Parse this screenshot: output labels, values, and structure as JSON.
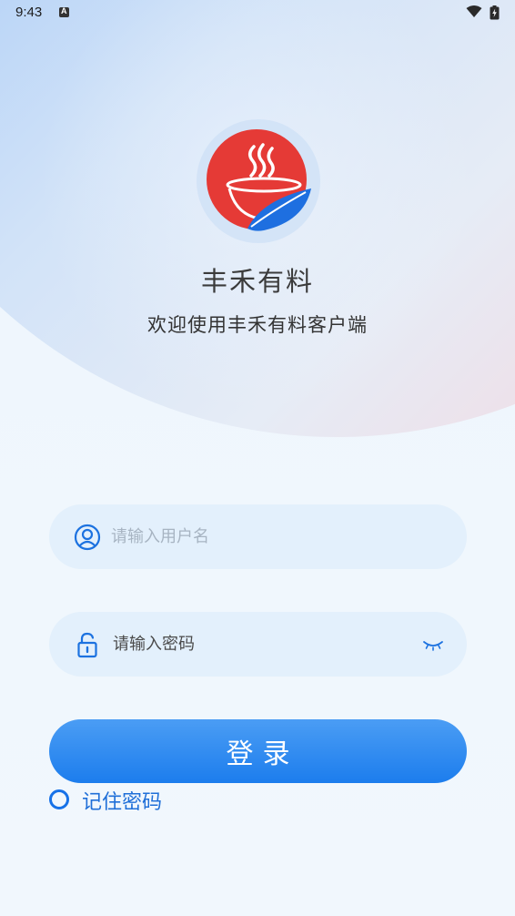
{
  "status_bar": {
    "time": "9:43",
    "icons": [
      "notification-a-icon",
      "wifi-icon",
      "battery-charging-icon"
    ]
  },
  "app": {
    "logo_icon": "steaming-bowl-leaf-logo",
    "title": "丰禾有料",
    "subtitle": "欢迎使用丰禾有料客户端"
  },
  "form": {
    "username": {
      "icon": "user-icon",
      "placeholder": "请输入用户名",
      "value": ""
    },
    "password": {
      "icon": "lock-icon",
      "placeholder": "请输入密码",
      "value": "",
      "toggle_icon": "eye-closed-icon"
    },
    "login_label": "登录",
    "remember_label": "记住密码",
    "remember_checked": false
  },
  "colors": {
    "accent": "#1a78ea",
    "input_bg": "#e3f0fc",
    "logo_red": "#e53a36",
    "logo_blue": "#1e6fe0"
  }
}
